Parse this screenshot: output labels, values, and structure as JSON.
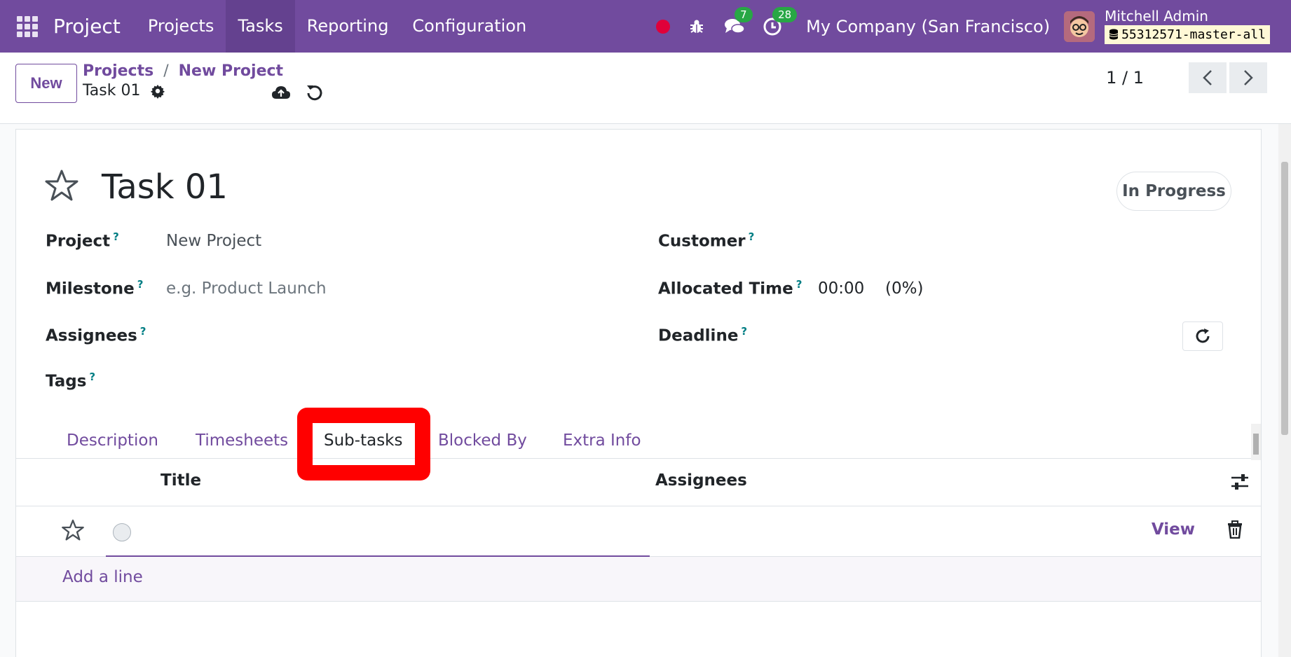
{
  "navbar": {
    "app_name": "Project",
    "menu": [
      "Projects",
      "Tasks",
      "Reporting",
      "Configuration"
    ],
    "active_menu": "Tasks",
    "chat_count": "7",
    "activity_count": "28",
    "company": "My Company (San Francisco)",
    "user_name": "Mitchell Admin",
    "database": "55312571-master-all",
    "colors": {
      "brand": "#714b9e",
      "badge": "#28a745",
      "recording": "#e0003a"
    }
  },
  "control": {
    "new_label": "New",
    "breadcrumb": [
      "Projects",
      "New Project"
    ],
    "breadcrumb_sep": "/",
    "record_name": "Task 01",
    "pager": "1 / 1"
  },
  "form": {
    "title": "Task 01",
    "stage": "In Progress",
    "help_mark": "?",
    "fields": {
      "project_label": "Project",
      "project_value": "New Project",
      "milestone_label": "Milestone",
      "milestone_placeholder": "e.g. Product Launch",
      "assignees_label": "Assignees",
      "tags_label": "Tags",
      "customer_label": "Customer",
      "allocated_label": "Allocated Time",
      "allocated_value": "00:00",
      "allocated_percent": "(0%)",
      "deadline_label": "Deadline"
    },
    "tabs": [
      "Description",
      "Timesheets",
      "Sub-tasks",
      "Blocked By",
      "Extra Info"
    ],
    "active_tab": "Sub-tasks",
    "list": {
      "columns": [
        "Title",
        "Assignees"
      ],
      "row_view": "View",
      "add_line": "Add a line"
    },
    "colors": {
      "highlight": "#ff0000",
      "link": "#714b9e"
    }
  }
}
